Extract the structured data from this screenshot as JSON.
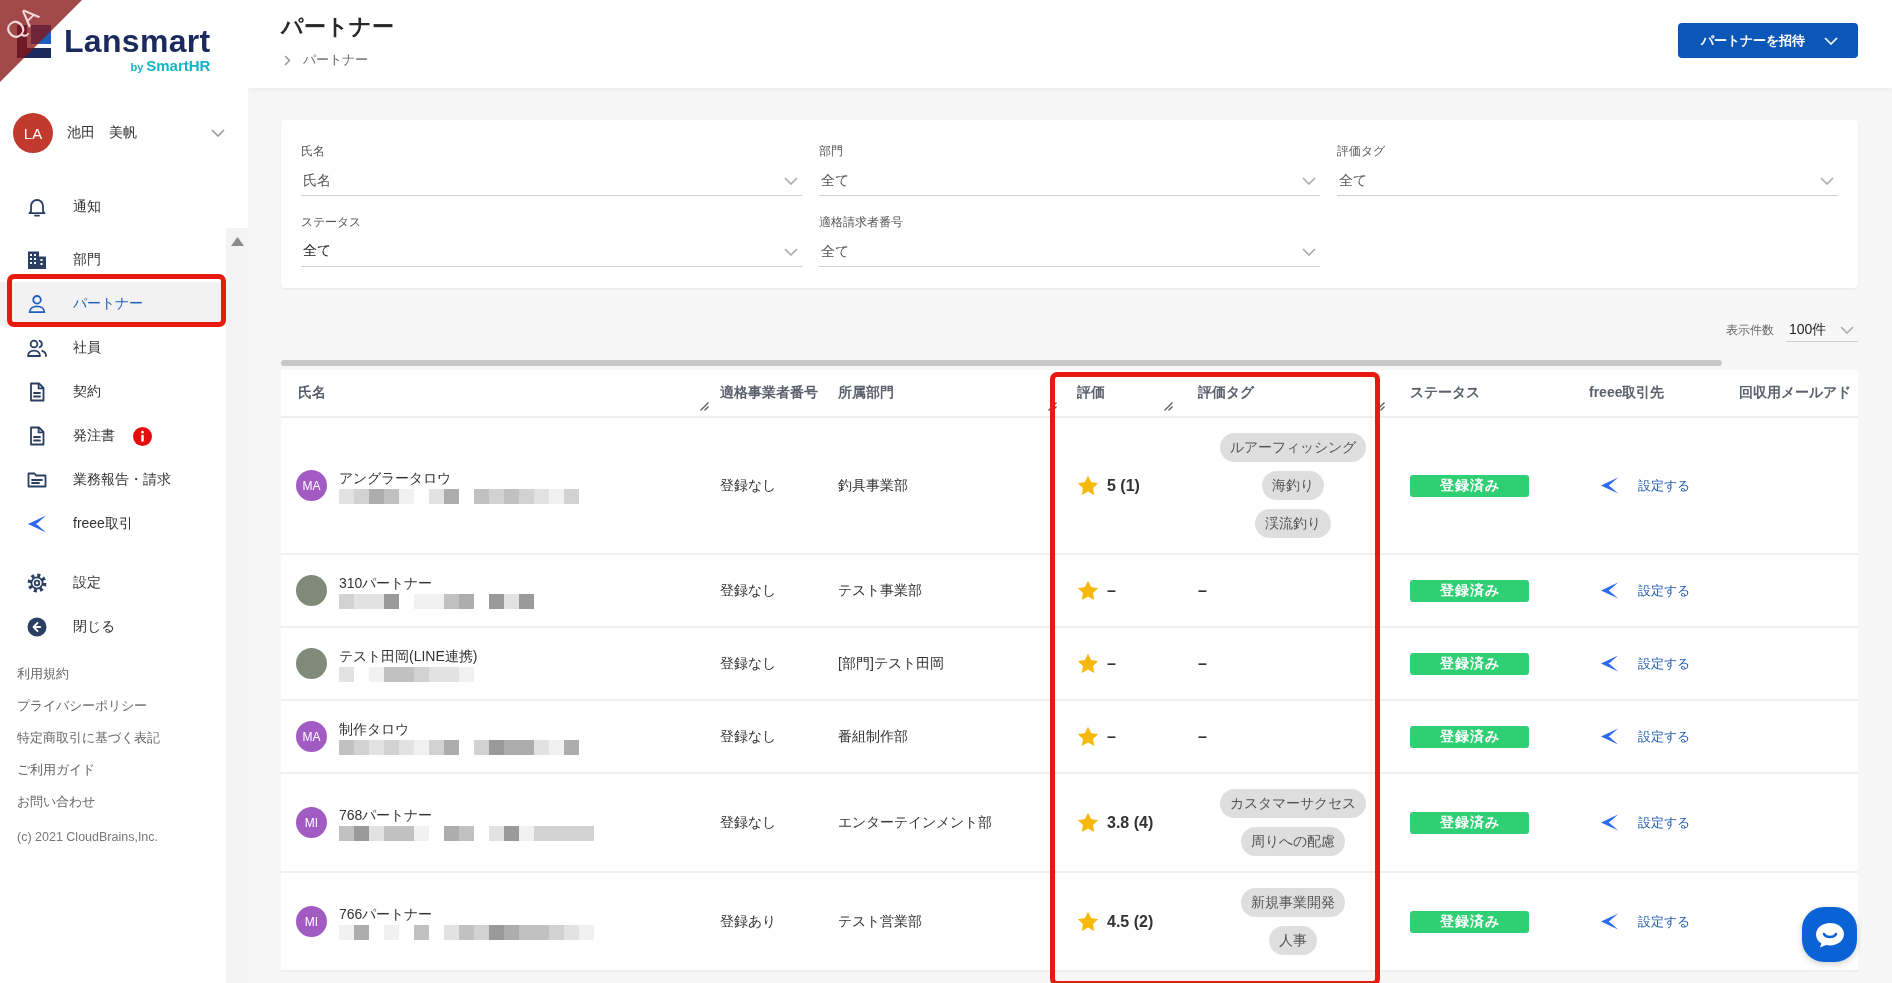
{
  "sidebar": {
    "ribbon": {
      "text": "QA"
    },
    "logo": {
      "name": "Lansmart",
      "by": "by",
      "brand": "SmartHR"
    },
    "user": {
      "initials": "LA",
      "name": "池田　美帆"
    },
    "groups": [
      {
        "items": [
          {
            "label": "通知",
            "selected": false,
            "highlighted": false,
            "alert": false
          }
        ]
      },
      {
        "items": [
          {
            "label": "部門",
            "selected": false,
            "highlighted": false,
            "alert": false
          },
          {
            "label": "パートナー",
            "selected": true,
            "highlighted": true,
            "alert": false
          },
          {
            "label": "社員",
            "selected": false,
            "highlighted": false,
            "alert": false
          },
          {
            "label": "契約",
            "selected": false,
            "highlighted": false,
            "alert": false
          },
          {
            "label": "発注書",
            "selected": false,
            "highlighted": false,
            "alert": true
          },
          {
            "label": "業務報告・請求",
            "selected": false,
            "highlighted": false,
            "alert": false
          },
          {
            "label": "freee取引",
            "selected": false,
            "highlighted": false,
            "alert": false
          }
        ]
      },
      {
        "items": [
          {
            "label": "設定",
            "selected": false,
            "highlighted": false,
            "alert": false
          },
          {
            "label": "閉じる",
            "selected": false,
            "highlighted": false,
            "alert": false
          }
        ]
      }
    ],
    "footer_links": [
      "利用規約",
      "プライバシーポリシー",
      "特定商取引に基づく表記",
      "ご利用ガイド",
      "お問い合わせ"
    ],
    "copyright": "(c) 2021 CloudBrains,Inc."
  },
  "header": {
    "title": "パートナー",
    "breadcrumb": [
      "パートナー"
    ],
    "invite_button": "パートナーを招待"
  },
  "filters": [
    {
      "label": "氏名",
      "placeholder": "氏名"
    },
    {
      "label": "部門",
      "placeholder": "全て"
    },
    {
      "label": "評価タグ",
      "placeholder": "全て"
    },
    {
      "label": "ステータス",
      "value": "全て"
    },
    {
      "label": "適格請求者番号",
      "placeholder": "全て"
    }
  ],
  "page_size": {
    "label": "表示件数",
    "value": "100件"
  },
  "table": {
    "columns": [
      {
        "label": "氏名",
        "resizable": true,
        "highlighted": false
      },
      {
        "label": "適格事業者番号",
        "resizable": false,
        "highlighted": false
      },
      {
        "label": "所属部門",
        "resizable": true,
        "highlighted": false
      },
      {
        "label": "評価",
        "resizable": true,
        "highlighted": true
      },
      {
        "label": "評価タグ",
        "resizable": true,
        "highlighted": true
      },
      {
        "label": "ステータス",
        "resizable": false,
        "highlighted": false
      },
      {
        "label": "freee取引先",
        "resizable": false,
        "highlighted": false
      },
      {
        "label": "回収用メールアド",
        "resizable": false,
        "highlighted": false
      }
    ],
    "rows": [
      {
        "avatar": {
          "kind": "initials",
          "text": "MA"
        },
        "name": "アングラータロウ",
        "email_pixelated": true,
        "invoice_number": "登録なし",
        "department": "釣具事業部",
        "rating": "5 (1)",
        "tags": [
          "ルアーフィッシング",
          "海釣り",
          "渓流釣り"
        ],
        "status": "登録済み",
        "freee_link": "設定する"
      },
      {
        "avatar": {
          "kind": "photo"
        },
        "name": "310パートナー",
        "email_pixelated": true,
        "invoice_number": "登録なし",
        "department": "テスト事業部",
        "rating": "–",
        "no_tags": "–",
        "status": "登録済み",
        "freee_link": "設定する"
      },
      {
        "avatar": {
          "kind": "photo"
        },
        "name": "テスト田岡(LINE連携)",
        "email_pixelated": true,
        "invoice_number": "登録なし",
        "department": "[部門]テスト田岡",
        "rating": "–",
        "no_tags": "–",
        "status": "登録済み",
        "freee_link": "設定する"
      },
      {
        "avatar": {
          "kind": "initials",
          "text": "MA"
        },
        "name": "制作タロウ",
        "email_pixelated": true,
        "invoice_number": "登録なし",
        "department": "番組制作部",
        "rating": "–",
        "no_tags": "–",
        "status": "登録済み",
        "freee_link": "設定する"
      },
      {
        "avatar": {
          "kind": "initials",
          "text": "MI"
        },
        "name": "768パートナー",
        "email_pixelated": true,
        "invoice_number": "登録なし",
        "department": "エンターテインメント部",
        "rating": "3.8 (4)",
        "tags": [
          "カスタマーサクセス",
          "周りへの配慮"
        ],
        "status": "登録済み",
        "freee_link": "設定する"
      },
      {
        "avatar": {
          "kind": "initials",
          "text": "MI"
        },
        "name": "766パートナー",
        "email_pixelated": true,
        "invoice_number": "登録あり",
        "department": "テスト営業部",
        "rating": "4.5 (2)",
        "tags": [
          "新規事業開発",
          "人事"
        ],
        "status": "登録済み",
        "freee_link": "設定する"
      }
    ]
  }
}
